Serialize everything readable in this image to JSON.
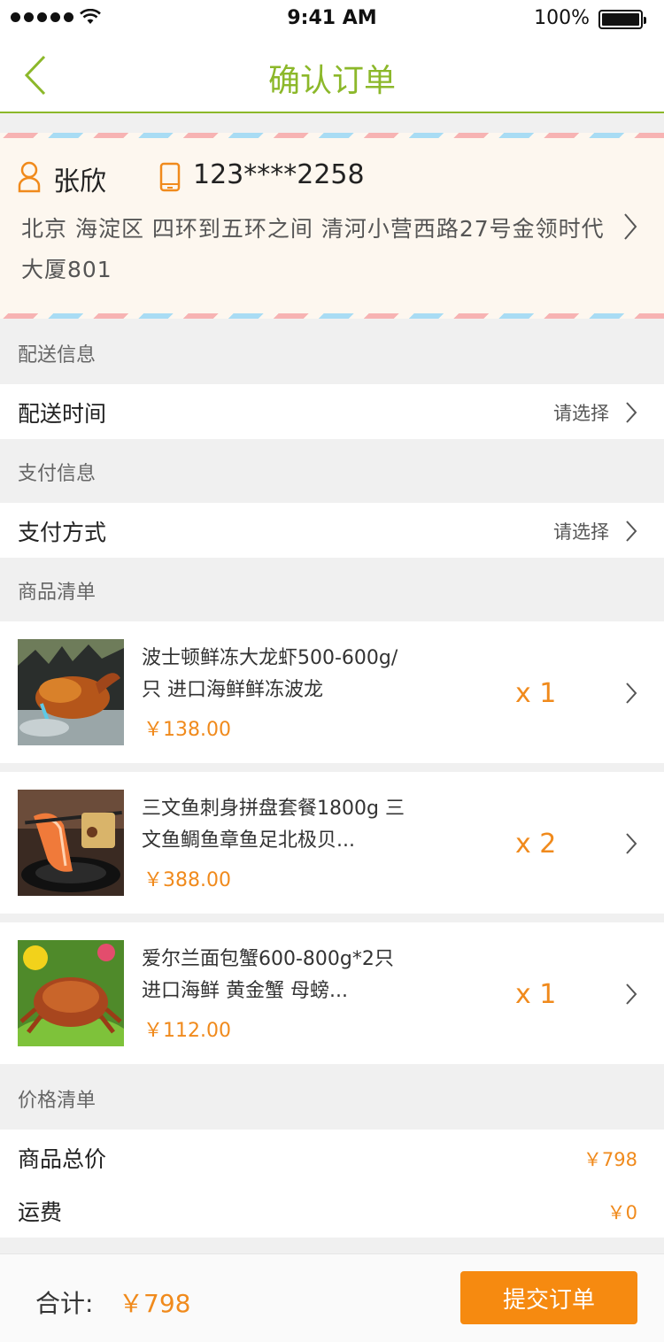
{
  "status_bar": {
    "time": "9:41 AM",
    "battery": "100%"
  },
  "header": {
    "title": "确认订单"
  },
  "address": {
    "name": "张欣",
    "phone": "123****2258",
    "line": "北京 海淀区 四环到五环之间 清河小营西路27号金领时代大厦801"
  },
  "delivery": {
    "section_title": "配送信息",
    "label": "配送时间",
    "hint": "请选择"
  },
  "payment": {
    "section_title": "支付信息",
    "label": "支付方式",
    "hint": "请选择"
  },
  "products": {
    "section_title": "商品清单",
    "items": [
      {
        "name": "波士顿鲜冻大龙虾500-600g/只 进口海鲜鲜冻波龙",
        "price": "￥138.00",
        "qty": "x 1",
        "image": "lobster"
      },
      {
        "name": "三文鱼刺身拼盘套餐1800g 三文鱼鲷鱼章鱼足北极贝...",
        "price": "￥388.00",
        "qty": "x 2",
        "image": "salmon-platter"
      },
      {
        "name": "爱尔兰面包蟹600-800g*2只 进口海鲜 黄金蟹 母螃...",
        "price": "￥112.00",
        "qty": "x 1",
        "image": "crab"
      }
    ]
  },
  "pricing": {
    "section_title": "价格清单",
    "rows": [
      {
        "label": "商品总价",
        "value": "￥798"
      },
      {
        "label": "运费",
        "value": "￥0"
      }
    ]
  },
  "footer": {
    "total_label": "合计:",
    "total_value": "￥798",
    "submit_label": "提交订单"
  },
  "colors": {
    "accent_green": "#8cb82a",
    "accent_orange": "#f08a1c",
    "button_orange": "#f68a10"
  }
}
